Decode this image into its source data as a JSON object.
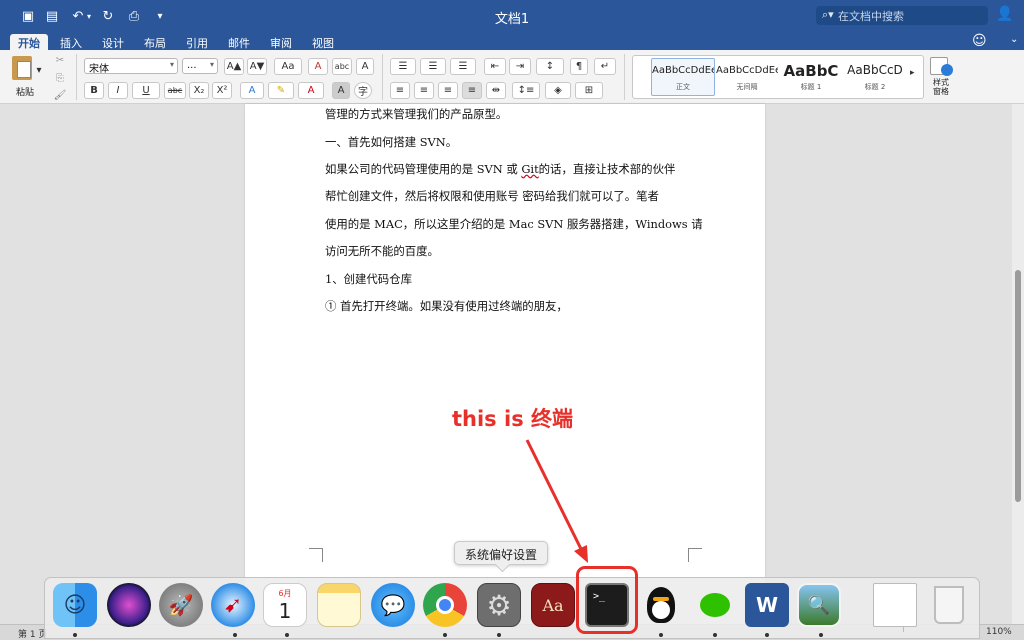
{
  "window": {
    "title": "文档1",
    "search_placeholder": "在文档中搜索"
  },
  "ribbon": {
    "tabs": [
      "开始",
      "插入",
      "设计",
      "布局",
      "引用",
      "邮件",
      "审阅",
      "视图"
    ],
    "paste_label": "粘贴",
    "font_name": "宋体",
    "font_size": "...",
    "styles": [
      {
        "preview": "AaBbCcDdEe",
        "name": "正文"
      },
      {
        "preview": "AaBbCcDdEe",
        "name": "无间隔"
      },
      {
        "preview": "AaBbC",
        "name": "标题 1"
      },
      {
        "preview": "AaBbCcD",
        "name": "标题 2"
      }
    ],
    "styles_pane_label": "样式窗格",
    "buttons": {
      "bold": "B",
      "italic": "I",
      "underline": "U",
      "strike": "abc",
      "subscript": "X₂",
      "superscript": "X²",
      "grow": "A▲",
      "shrink": "A▼",
      "case": "Aa",
      "clear": "A",
      "pinyin": "abc",
      "charborder": "A",
      "texteffect": "A",
      "highlight": "✎",
      "fontcolor": "A",
      "shading": "A",
      "enclose": "字"
    }
  },
  "document": {
    "paragraphs": [
      "管理的方式来管理我们的产品原型。",
      "一、首先如何搭建 SVN。",
      "如果公司的代码管理使用的是 SVN 或 ",
      "的话，直接让技术部的伙伴",
      "帮忙创建文件，然后将权限和使用账号  密码给我们就可以了。笔者",
      "使用的是 MAC，所以这里介绍的是 Mac  SVN 服务器搭建，Windows 请",
      "访问无所不能的百度。",
      "1、创建代码仓库",
      "①  首先打开终端。如果没有使用过终端的朋友，"
    ],
    "misspelled_word": "Git"
  },
  "annotation": {
    "text": "this is 终端",
    "color": "#e8302a"
  },
  "dock": {
    "tooltip": "系统偏好设置",
    "items": [
      "finder",
      "siri",
      "launchpad",
      "safari",
      "calendar",
      "notes",
      "messages",
      "chrome",
      "system-preferences",
      "dictionary",
      "terminal",
      "qq",
      "wechat",
      "word",
      "preview",
      "document-stack",
      "trash"
    ],
    "calendar_month": "6月",
    "calendar_day": "1",
    "dictionary_text": "Aa",
    "terminal_prompt": ">_",
    "word_letter": "W"
  },
  "statusbar": {
    "page_label": "第 1 页",
    "zoom": "110%"
  },
  "colors": {
    "titlebar": "#2b579a",
    "annotation": "#e8302a"
  }
}
